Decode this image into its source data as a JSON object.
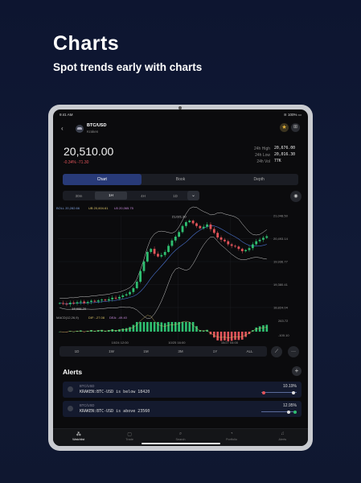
{
  "promo": {
    "title": "Charts",
    "subtitle": "Spot trends early with charts"
  },
  "status": {
    "time": "9:41 AM",
    "battery": "100%"
  },
  "header": {
    "back_icon": "chevron-left-icon",
    "pair": "BTC/USD",
    "exchange": "Kraken"
  },
  "ticker": {
    "price": "20,510.00",
    "change": "-0.34%  -71.30",
    "stats": [
      {
        "label": "24h High",
        "value": "20,676.00"
      },
      {
        "label": "24h Low",
        "value": "20,016.30"
      },
      {
        "label": "24h Vol",
        "value": "77K"
      }
    ]
  },
  "tabs": [
    "Chart",
    "Book",
    "Depth"
  ],
  "active_tab": "Chart",
  "timeframes": [
    "30m",
    "1H",
    "4H",
    "1D"
  ],
  "active_timeframe": "1H",
  "overlay_label": {
    "a": "BOLL 20,282.66",
    "b": "UB 20,604.61",
    "c": "LB 20,065.75"
  },
  "macd_label": {
    "a": "MACD(12,26,9)",
    "b": "DIF: -27.08",
    "c": "DEA: -49.40"
  },
  "ranges": [
    "1D",
    "1W",
    "1M",
    "3M",
    "1Y",
    "ALL"
  ],
  "alerts": {
    "title": "Alerts",
    "items": [
      {
        "pair": "BTC/USD",
        "condition": "KRAKEN:BTC-USD is below 18420",
        "percent": "10.19%"
      },
      {
        "pair": "BTC/USD",
        "condition": "KRAKEN:BTC-USD is above 23560",
        "percent": "12.95%"
      }
    ]
  },
  "tabbar": [
    "Watchlist",
    "Trade",
    "Search",
    "Portfolio",
    "Alerts"
  ],
  "colors": {
    "up": "#2fbf71",
    "down": "#e2545a",
    "accent": "#283a78",
    "band": "#c9c9c9",
    "ma": "#4a73d1"
  },
  "chart_data": {
    "type": "candlestick",
    "price_labels": [
      "21,048.50",
      "20,493.14",
      "19,936.77",
      "19,380.41",
      "18,824.04"
    ],
    "extreme_labels": {
      "high": "21,021.20",
      "low": "18,688.20"
    },
    "time_labels": [
      "10/24 12:00",
      "10/25 16:00",
      "10/27 04:00"
    ],
    "macd_labels": [
      "263.72",
      "-100.10"
    ],
    "close": [
      18760,
      18740,
      18730,
      18770,
      18750,
      18780,
      18800,
      18760,
      18790,
      18820,
      18800,
      18830,
      18850,
      18830,
      18860,
      18900,
      18880,
      18920,
      18960,
      18990,
      19050,
      19150,
      19320,
      19600,
      19850,
      20100,
      20180,
      20050,
      19980,
      20020,
      20100,
      20260,
      20400,
      20500,
      20620,
      20780,
      20880,
      20920,
      20850,
      20780,
      20720,
      20760,
      20820,
      20700,
      20600,
      20480,
      20420,
      20380,
      20300,
      20260,
      20240,
      20180,
      20120,
      20150,
      20200,
      20300,
      20380,
      20420,
      20470,
      20510
    ]
  }
}
